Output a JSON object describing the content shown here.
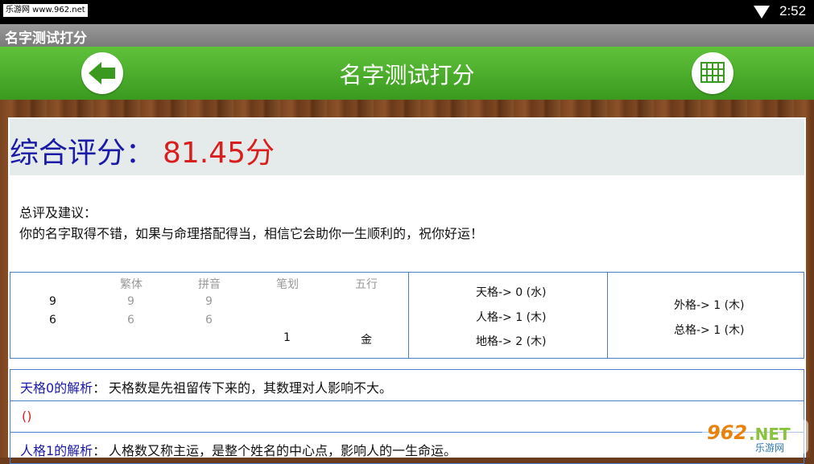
{
  "status_bar": {
    "source_label": "乐游网 www.962.net",
    "time": "2:52"
  },
  "app_title": "名字测试打分",
  "header": {
    "title": "名字测试打分",
    "back_icon": "arrow-left-icon",
    "menu_icon": "grid-icon",
    "accent_color": "#4cae2c"
  },
  "score": {
    "label": "综合评分：",
    "value": "81.45分",
    "label_color": "#1a1aa6",
    "value_color": "#d81e1e"
  },
  "summary": {
    "title": "总评及建议：",
    "text": "你的名字取得不错，如果与命理搭配得当，相信它会助你一生顺利的，祝你好运！"
  },
  "char_table": {
    "headers": [
      "繁体",
      "拼音",
      "笔划",
      "五行"
    ],
    "rows": [
      {
        "char": "9",
        "traditional": "9",
        "pinyin": "9",
        "strokes": "",
        "element": ""
      },
      {
        "char": "6",
        "traditional": "6",
        "pinyin": "6",
        "strokes": "",
        "element": ""
      },
      {
        "char": "",
        "traditional": "",
        "pinyin": "",
        "strokes": "1",
        "element": "金"
      }
    ]
  },
  "ge_middle": [
    "天格-> 0 (水)",
    "人格-> 1 (木)",
    "地格-> 2 (木)"
  ],
  "ge_right": [
    "外格-> 1 (木)",
    "总格-> 1 (木)"
  ],
  "analysis": [
    {
      "key": "天格0的解析",
      "sep": "：",
      "text": "天格数是先祖留传下来的，其数理对人影响不大。"
    },
    {
      "key": "",
      "sep": "",
      "text": "()"
    },
    {
      "key": "人格1的解析",
      "sep": "：",
      "text": "人格数又称主运，是整个姓名的中心点，影响人的一生命运。"
    }
  ],
  "watermark": {
    "brand": "962",
    "dot": ".NET",
    "sub": "乐游网"
  }
}
